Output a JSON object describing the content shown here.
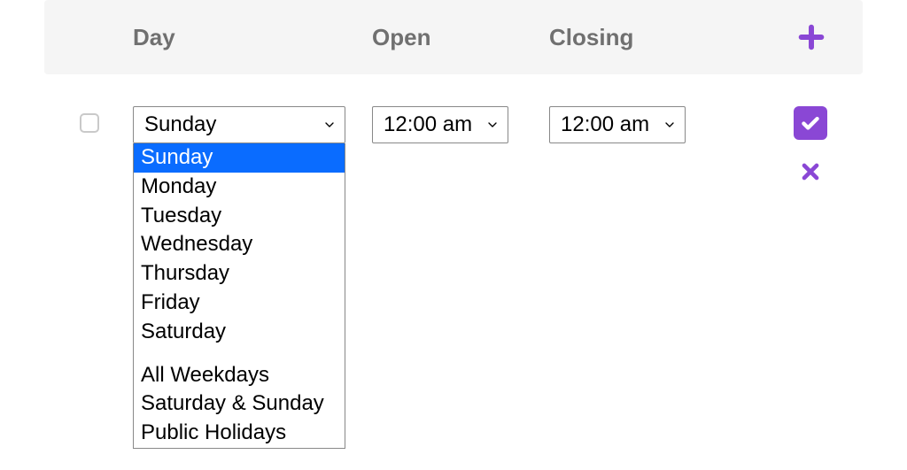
{
  "headers": {
    "day": "Day",
    "open": "Open",
    "closing": "Closing"
  },
  "row": {
    "day_selected": "Sunday",
    "open_time": "12:00 am",
    "close_time": "12:00 am"
  },
  "day_options": [
    "Sunday",
    "Monday",
    "Tuesday",
    "Wednesday",
    "Thursday",
    "Friday",
    "Saturday"
  ],
  "day_options_group2": [
    "All Weekdays",
    "Saturday & Sunday",
    "Public Holidays"
  ],
  "colors": {
    "accent": "#8a47d5",
    "highlight": "#0a6cff"
  }
}
